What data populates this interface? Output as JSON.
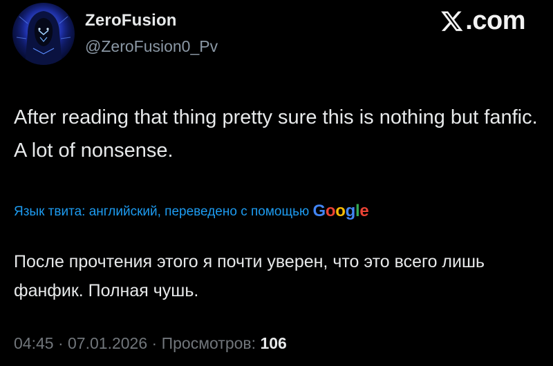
{
  "author": {
    "display_name": "ZeroFusion",
    "handle": "@ZeroFusion0_Pv",
    "avatar_icon": "hooded-figure-avatar"
  },
  "brand": {
    "icon": "x-logo-icon",
    "text": ".com"
  },
  "tweet": {
    "text": "After reading that thing pretty sure this is nothing but fanfic. A lot of nonsense."
  },
  "translation": {
    "notice": "Язык твита: английский, переведено с помощью",
    "provider_letters": [
      "G",
      "o",
      "o",
      "g",
      "l",
      "e"
    ],
    "provider_colors": [
      "#4285f4",
      "#ea4335",
      "#fbbc05",
      "#4285f4",
      "#34a853",
      "#ea4335"
    ],
    "text": "После прочтения этого я почти уверен, что это всего лишь фанфик. Полная чушь."
  },
  "meta": {
    "time": "04:45",
    "separator": "·",
    "date": "07.01.2026",
    "views_label": "Просмотров:",
    "views_count": "106"
  },
  "colors": {
    "background": "#000000",
    "text_primary": "#e7e9ea",
    "text_secondary": "#71767b",
    "link": "#1d9bf0"
  }
}
